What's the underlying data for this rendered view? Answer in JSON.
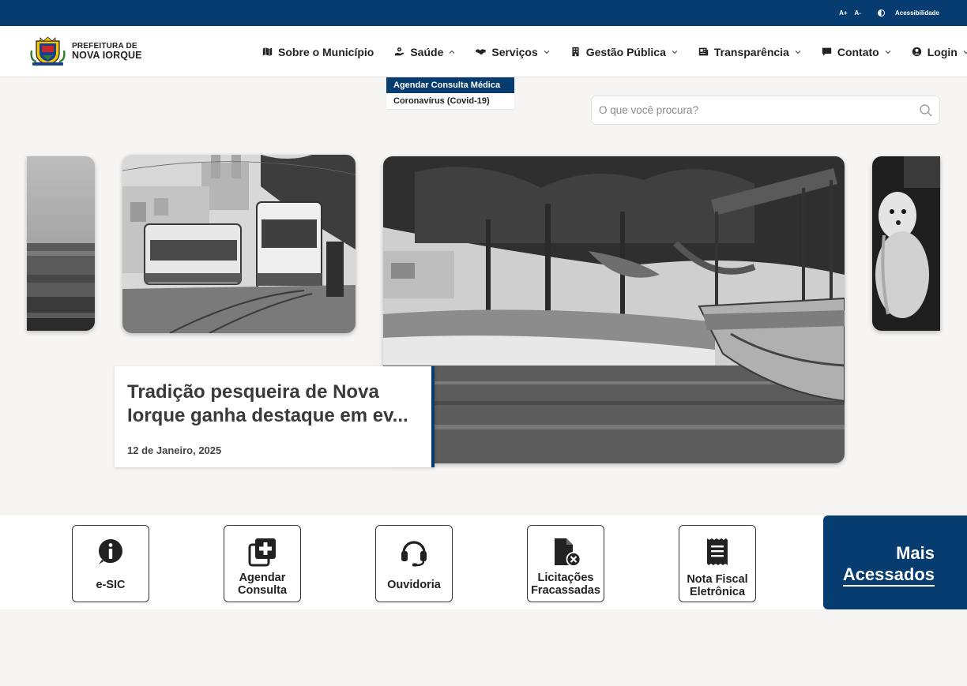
{
  "topbar": {
    "font_increase": "A+",
    "font_decrease": "A-",
    "accessibility": "Acessibilidade"
  },
  "logo": {
    "line1": "PREFEITURA DE",
    "line2": "NOVA IORQUE"
  },
  "nav": {
    "items": [
      {
        "label": "Sobre o Município",
        "icon": "map-icon"
      },
      {
        "label": "Saúde",
        "icon": "health-hand-icon"
      },
      {
        "label": "Serviços",
        "icon": "handshake-icon"
      },
      {
        "label": "Gestão Pública",
        "icon": "building-icon"
      },
      {
        "label": "Transparência",
        "icon": "newspaper-icon"
      },
      {
        "label": "Contato",
        "icon": "chat-icon"
      },
      {
        "label": "Login",
        "icon": "user-circle-icon"
      }
    ]
  },
  "dropdown": {
    "items": [
      "Agendar Consulta Médica",
      "Coronavírus (Covid-19)"
    ]
  },
  "search": {
    "placeholder": "O que você procura?"
  },
  "carousel": {
    "caption_title": "Tradição pesqueira de Nova Iorque ganha destaque em ev...",
    "caption_date": "12 de Janeiro, 2025"
  },
  "quick_access": {
    "items": [
      {
        "label": "e-SIC",
        "icon": "info-icon"
      },
      {
        "label": "Agendar Consulta",
        "icon": "medical-add-icon"
      },
      {
        "label": "Ouvidoria",
        "icon": "headset-icon"
      },
      {
        "label": "Licitações Fracassadas",
        "icon": "file-cancel-icon"
      },
      {
        "label": "Nota Fiscal Eletrônica",
        "icon": "receipt-icon"
      }
    ],
    "mais_line1": "Mais",
    "mais_line2": "Acessados"
  },
  "colors": {
    "primary": "#063c6f",
    "background": "#f6f5f4"
  }
}
